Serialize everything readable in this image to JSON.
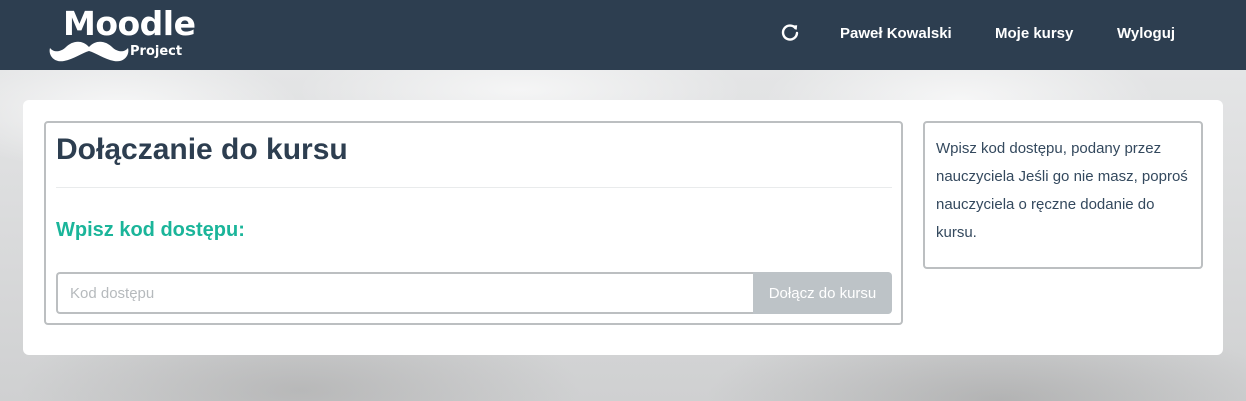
{
  "navbar": {
    "logo_text": "Moodle",
    "logo_subtext": "Project",
    "refresh_icon": "refresh-icon",
    "user_name": "Paweł Kowalski",
    "my_courses": "Moje kursy",
    "logout": "Wyloguj",
    "bg_color": "#2d3e50"
  },
  "main": {
    "title": "Dołączanie do kursu",
    "subtitle": "Wpisz kod dostępu:",
    "input_placeholder": "Kod dostępu",
    "input_value": "",
    "join_button": "Dołącz do kursu",
    "accent_color": "#1bb59a"
  },
  "side": {
    "info_text": "Wpisz kod dostępu, podany przez nauczyciela Jeśli go nie masz, poproś nauczyciela o ręczne dodanie do kursu."
  }
}
